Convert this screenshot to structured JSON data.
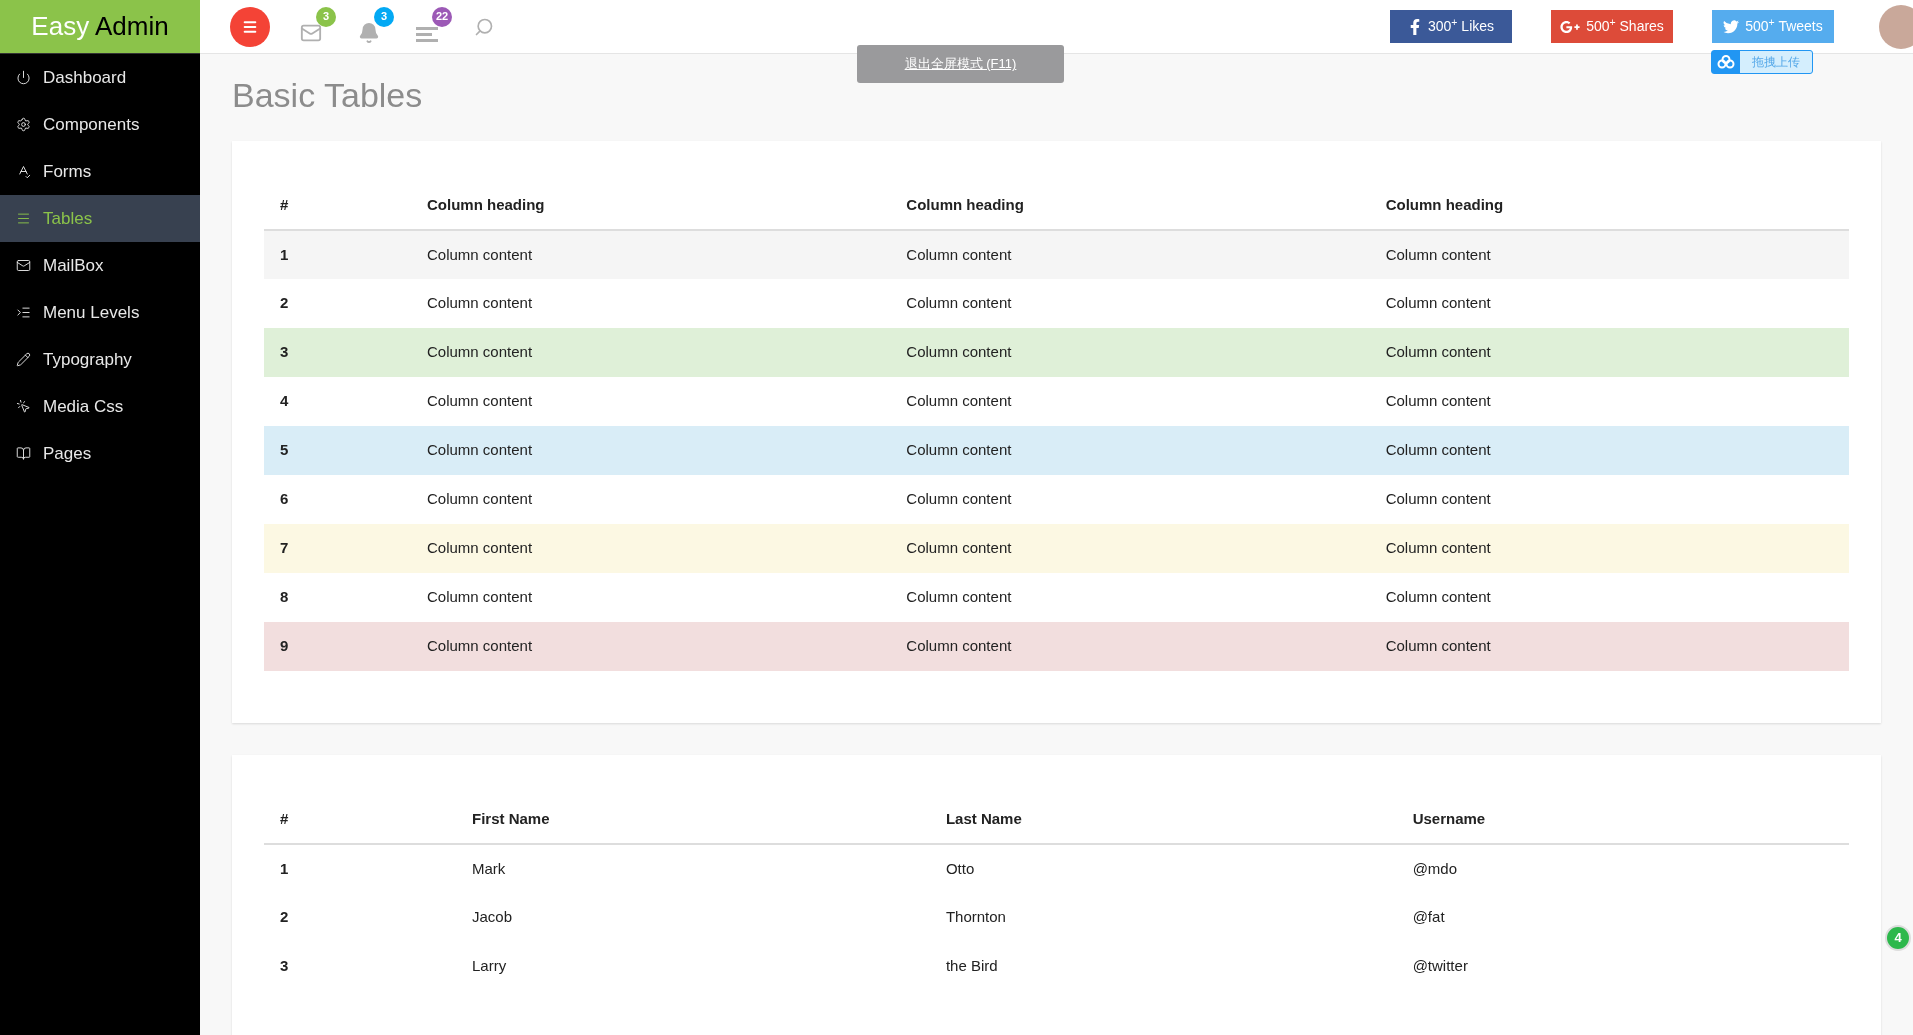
{
  "brand": {
    "first": "Easy",
    "second": "Admin"
  },
  "topbar": {
    "badges": [
      {
        "kind": "mail",
        "count": "3",
        "color": "#8bc34a"
      },
      {
        "kind": "bell",
        "count": "3",
        "color": "#03a9f4"
      },
      {
        "kind": "list",
        "count": "22",
        "color": "#9c59b6"
      }
    ],
    "social": [
      {
        "kind": "facebook",
        "count": "300",
        "sup": "+",
        "label": "Likes",
        "color": "#3b5998"
      },
      {
        "kind": "google",
        "count": "500",
        "sup": "+",
        "label": "Shares",
        "color": "#dd4b39"
      },
      {
        "kind": "twitter",
        "count": "500",
        "sup": "+",
        "label": "Tweets",
        "color": "#55acee"
      }
    ],
    "upload_widget": {
      "label": "拖拽上传"
    },
    "fullscreen_toast": "退出全屏模式 (F11)"
  },
  "sidebar": {
    "items": [
      {
        "kind": "power",
        "label": "Dashboard",
        "selected": false
      },
      {
        "kind": "gear",
        "label": "Components",
        "selected": false
      },
      {
        "kind": "abc",
        "label": "Forms",
        "selected": false
      },
      {
        "kind": "lines",
        "label": "Tables",
        "selected": true
      },
      {
        "kind": "mail",
        "label": "MailBox",
        "selected": false
      },
      {
        "kind": "indent",
        "label": "Menu Levels",
        "selected": false
      },
      {
        "kind": "pencil",
        "label": "Typography",
        "selected": false
      },
      {
        "kind": "cursor",
        "label": "Media Css",
        "selected": false
      },
      {
        "kind": "book",
        "label": "Pages",
        "selected": false
      }
    ]
  },
  "page_title": "Basic Tables",
  "tables": [
    {
      "columns": [
        "#",
        "Column heading",
        "Column heading",
        "Column heading"
      ],
      "rows": [
        {
          "color": "#f5f5f5",
          "cells": [
            "1",
            "Column content",
            "Column content",
            "Column content"
          ]
        },
        {
          "color": "#ffffff",
          "cells": [
            "2",
            "Column content",
            "Column content",
            "Column content"
          ]
        },
        {
          "color": "#dff0d8",
          "cells": [
            "3",
            "Column content",
            "Column content",
            "Column content"
          ]
        },
        {
          "color": "#ffffff",
          "cells": [
            "4",
            "Column content",
            "Column content",
            "Column content"
          ]
        },
        {
          "color": "#d9edf7",
          "cells": [
            "5",
            "Column content",
            "Column content",
            "Column content"
          ]
        },
        {
          "color": "#ffffff",
          "cells": [
            "6",
            "Column content",
            "Column content",
            "Column content"
          ]
        },
        {
          "color": "#fcf8e3",
          "cells": [
            "7",
            "Column content",
            "Column content",
            "Column content"
          ]
        },
        {
          "color": "#ffffff",
          "cells": [
            "8",
            "Column content",
            "Column content",
            "Column content"
          ]
        },
        {
          "color": "#f2dede",
          "cells": [
            "9",
            "Column content",
            "Column content",
            "Column content"
          ]
        }
      ]
    },
    {
      "columns": [
        "#",
        "First Name",
        "Last Name",
        "Username"
      ],
      "rows": [
        {
          "color": "#ffffff",
          "cells": [
            "1",
            "Mark",
            "Otto",
            "@mdo"
          ]
        },
        {
          "color": "#ffffff",
          "cells": [
            "2",
            "Jacob",
            "Thornton",
            "@fat"
          ]
        },
        {
          "color": "#ffffff",
          "cells": [
            "3",
            "Larry",
            "the Bird",
            "@twitter"
          ]
        }
      ]
    }
  ],
  "floating_badge": "4"
}
